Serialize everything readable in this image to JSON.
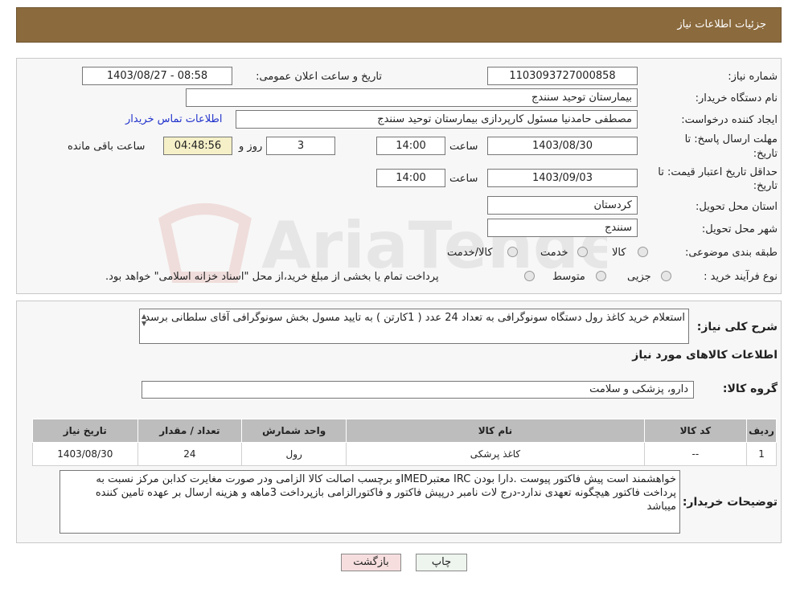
{
  "header": {
    "title": "جزئیات اطلاعات نیاز"
  },
  "form": {
    "need_number_label": "شماره نیاز:",
    "need_number": "1103093727000858",
    "announce_label": "تاریخ و ساعت اعلان عمومی:",
    "announce_value": "1403/08/27 - 08:58",
    "buyer_org_label": "نام دستگاه خریدار:",
    "buyer_org": "بیمارستان توحید سنندج",
    "creator_label": "ایجاد کننده درخواست:",
    "creator": "مصطفی حامدنیا مسئول کارپردازی بیمارستان توحید سنندج",
    "contact_link": "اطلاعات تماس خریدار",
    "deadline_label_1": "مهلت ارسال پاسخ: تا",
    "deadline_label_2": "تاریخ:",
    "deadline_date": "1403/08/30",
    "time_word": "ساعت",
    "deadline_time": "14:00",
    "days_value": "3",
    "days_word": "روز و",
    "remaining_time": "04:48:56",
    "remaining_word": "ساعت باقی مانده",
    "validity_label_1": "حداقل تاریخ اعتبار قیمت: تا",
    "validity_label_2": "تاریخ:",
    "validity_date": "1403/09/03",
    "validity_time": "14:00",
    "province_label": "استان محل تحویل:",
    "province": "کردستان",
    "city_label": "شهر محل تحویل:",
    "city": "سنندج",
    "category_label": "طبقه بندی موضوعی:",
    "category_options": [
      "کالا",
      "خدمت",
      "کالا/خدمت"
    ],
    "process_label": "نوع فرآیند خرید :",
    "process_options": [
      "جزیی",
      "متوسط"
    ],
    "process_note": "پرداخت تمام یا بخشی از مبلغ خرید،از محل \"اسناد خزانه اسلامی\" خواهد بود."
  },
  "summary": {
    "desc_label": "شرح کلی نیاز:",
    "desc_text": "استعلام خرید کاغذ رول دستگاه سونوگرافی به تعداد 24 عدد ( 1کارتن ) به تایید مسول بخش سونوگرافی آقای سلطانی برسد",
    "goods_info_title": "اطلاعات کالاهای مورد نیاز",
    "group_label": "گروه کالا:",
    "group_value": "دارو، پزشکی و سلامت"
  },
  "table": {
    "headers": [
      "ردیف",
      "کد کالا",
      "نام کالا",
      "واحد شمارش",
      "تعداد / مقدار",
      "تاریخ نیاز"
    ],
    "rows": [
      [
        "1",
        "--",
        "کاغذ پرشکی",
        "رول",
        "24",
        "1403/08/30"
      ]
    ]
  },
  "buyer_notes": {
    "label": "توضیحات خریدار:",
    "text": "خواهشمند است پیش فاکتور پیوست .دارا بودن IRC معتبرIMEDو برچسب اصالت کالا الزامی ودر صورت مغایرت کدابن مرکز نسبت به پرداخت فاکتور هیچگونه تعهدی ندارد-درج لات نامبر درپیش فاکتور و فاکتورالزامی  بازپرداخت 3ماهه و هزینه ارسال بر عهده تامین کننده میباشد"
  },
  "buttons": {
    "print": "چاپ",
    "back": "بازگشت"
  },
  "watermark": {
    "text": "AriaTender.neT"
  }
}
